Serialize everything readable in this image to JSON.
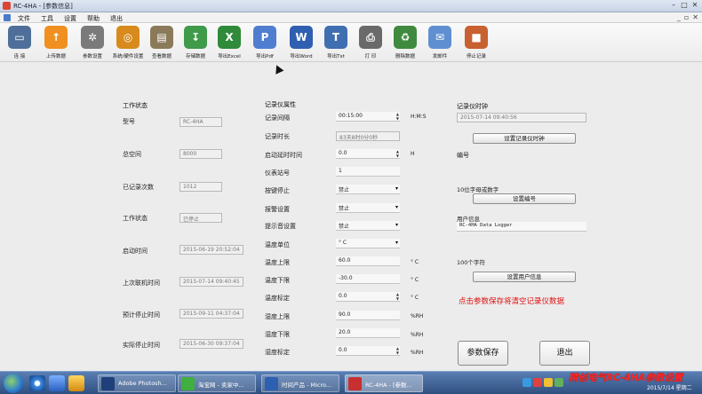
{
  "window": {
    "title": "RC-4HA - [参数信息]"
  },
  "menu": {
    "items": [
      "文件",
      "工具",
      "设置",
      "帮助",
      "退出"
    ]
  },
  "toolbar": {
    "buttons": [
      {
        "label": "连  接",
        "icon": "computer-icon",
        "color": "#4f6f9a"
      },
      {
        "label": "上传数据",
        "icon": "upload-icon",
        "color": "#f09020"
      },
      {
        "label": "参数设置",
        "icon": "gears-icon",
        "color": "#7a7a7a"
      },
      {
        "label": "系统/硬件设置",
        "icon": "hardware-icon",
        "color": "#d88a1c"
      },
      {
        "label": "查看数据",
        "icon": "view-data-icon",
        "color": "#8b7a5a"
      },
      {
        "label": "存储数据",
        "icon": "save-data-icon",
        "color": "#3f9a4a"
      },
      {
        "label": "导出Excel",
        "icon": "excel-icon",
        "color": "#2f8a3a"
      },
      {
        "label": "导出Pdf",
        "icon": "pdf-icon",
        "color": "#4f7ed0"
      },
      {
        "label": "导出Word",
        "icon": "word-icon",
        "color": "#2f5fb0"
      },
      {
        "label": "导出Txt",
        "icon": "txt-icon",
        "color": "#3f6fb0"
      },
      {
        "label": "打  印",
        "icon": "printer-icon",
        "color": "#6a6a6a"
      },
      {
        "label": "删除数据",
        "icon": "trash-icon",
        "color": "#3f8a3f"
      },
      {
        "label": "发邮件",
        "icon": "mail-icon",
        "color": "#5f8fd0"
      },
      {
        "label": "停止记录",
        "icon": "stop-record-icon",
        "color": "#c86030"
      }
    ]
  },
  "status": {
    "group_title": "工作状态",
    "model_label": "型号",
    "model_value": "RC-4HA",
    "total_space_label": "总空间",
    "total_space_value": "8000",
    "records_label": "已记录次数",
    "records_value": "1012",
    "work_state_label": "工作状态",
    "work_state_value": "已停止",
    "start_time_label": "启动时间",
    "start_time_value": "2015-06-19 20:52:04",
    "last_online_label": "上次联机时间",
    "last_online_value": "2015-07-14 09:40:45",
    "planned_stop_label": "预计停止时间",
    "planned_stop_value": "2015-09-11 04:37:04",
    "actual_stop_label": "实际停止时间",
    "actual_stop_value": "2015-06-30 09:37:04"
  },
  "props": {
    "group_title": "记录仪属性",
    "interval_label": "记录间隔",
    "interval_value": "00:15:00",
    "interval_unit": "H:M:S",
    "duration_label": "记录时长",
    "duration_value": "83天8时0分0秒",
    "start_delay_label": "启动延时时间",
    "start_delay_value": "0.0",
    "start_delay_unit": "H",
    "station_label": "仪表站号",
    "station_value": "1",
    "key_stop_label": "按键停止",
    "key_stop_value": "禁止",
    "alarm_label": "报警设置",
    "alarm_value": "禁止",
    "beep_label": "提示音设置",
    "beep_value": "禁止",
    "temp_unit_label": "温度单位",
    "temp_unit_value": "° C",
    "temp_upper_label": "温度上限",
    "temp_upper_value": "60.0",
    "temp_upper_unit": "° C",
    "temp_lower_label": "温度下限",
    "temp_lower_value": "-30.0",
    "temp_lower_unit": "° C",
    "temp_cal_label": "温度标定",
    "temp_cal_value": "0.0",
    "temp_cal_unit": "° C",
    "hum_upper_label": "湿度上限",
    "hum_upper_value": "90.0",
    "hum_upper_unit": "%RH",
    "hum_lower_label": "湿度下限",
    "hum_lower_value": "20.0",
    "hum_lower_unit": "%RH",
    "hum_cal_label": "湿度标定",
    "hum_cal_value": "0.0",
    "hum_cal_unit": "%RH"
  },
  "clock": {
    "label": "记录仪时钟",
    "value": "2015-07-14 09:40:56",
    "button": "设置记录仪时钟"
  },
  "serial": {
    "label": "编号",
    "hint": "10位字母或数字",
    "button": "设置编号"
  },
  "userinfo": {
    "label": "用户信息",
    "value": "RC-4HA Data Logger",
    "hint": "100个字符",
    "button": "设置用户信息"
  },
  "warning": "点击参数保存将清空记录仪数据",
  "actions": {
    "save": "参数保存",
    "exit": "退出"
  },
  "taskbar": {
    "tasks": [
      {
        "label": "Adobe Photosh...",
        "color": "#1f3f7a"
      },
      {
        "label": "淘宝网 - 卖家中...",
        "color": "#3faf3f"
      },
      {
        "label": "时间产品 - Micro...",
        "color": "#2f5fb0"
      },
      {
        "label": "RC-4HA - [参数...",
        "color": "#c83030"
      }
    ],
    "brand": "精创电气RC-4HA参数设置",
    "clock": "2015/7/14 星期二"
  }
}
